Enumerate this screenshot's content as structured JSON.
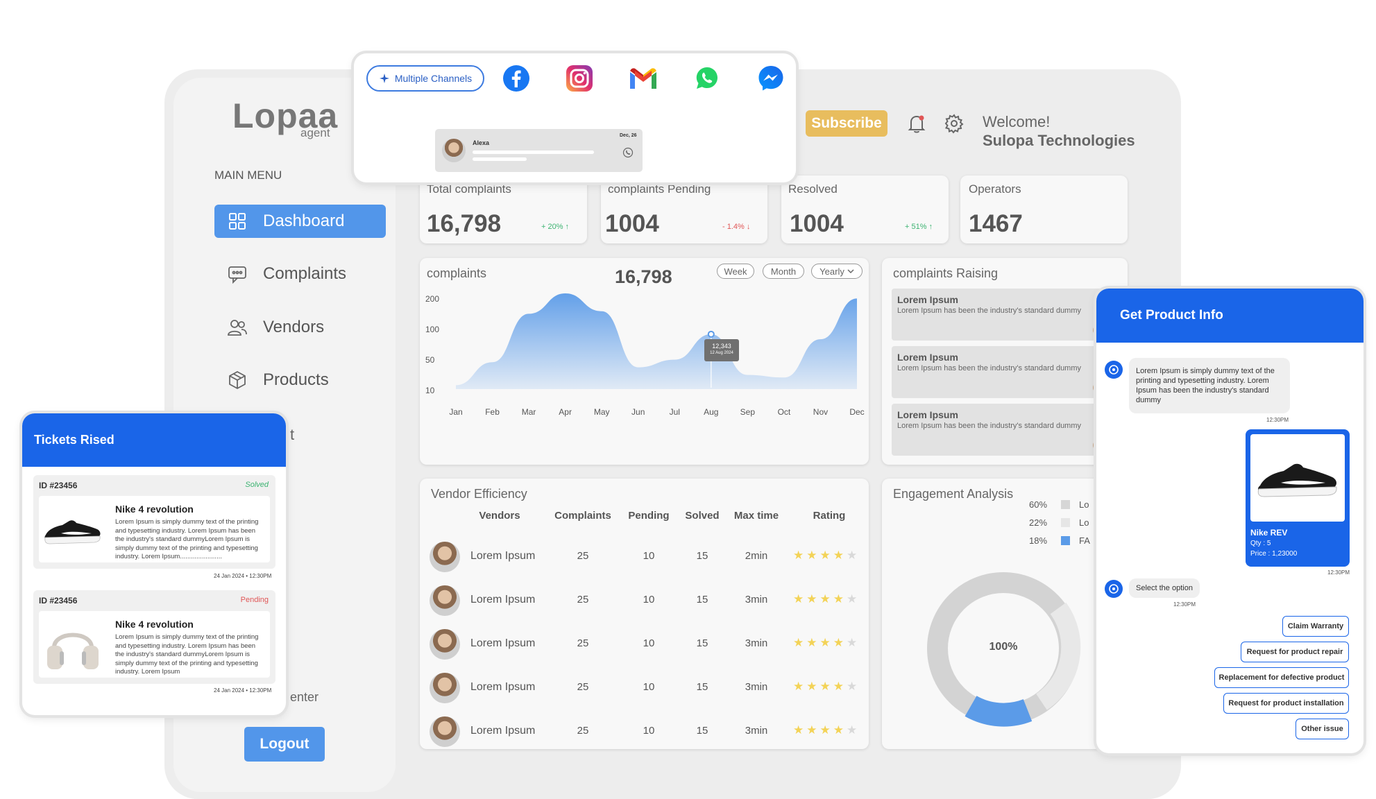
{
  "brand": {
    "name": "Lopaa",
    "sub": "agent"
  },
  "sidebar": {
    "menu_label": "MAIN MENU",
    "items": [
      {
        "label": "Dashboard",
        "icon": "grid-icon"
      },
      {
        "label": "Complaints",
        "icon": "chat-icon"
      },
      {
        "label": "Vendors",
        "icon": "users-icon"
      },
      {
        "label": "Products",
        "icon": "box-icon"
      }
    ],
    "partial_item": "t",
    "partial_item2": "enter",
    "logout_label": "Logout"
  },
  "header": {
    "subscribe_label": "Subscribe",
    "welcome": "Welcome!",
    "company": "Sulopa Technologies"
  },
  "stats": [
    {
      "title": "Total complaints",
      "value": "16,798",
      "trend": "+ 20% ↑",
      "trend_color": "#3cb371"
    },
    {
      "title": "complaints Pending",
      "value": "1004",
      "trend": "- 1.4% ↓",
      "trend_color": "#e05555"
    },
    {
      "title": "Resolved",
      "value": "1004",
      "trend": "+ 51% ↑",
      "trend_color": "#3cb371"
    },
    {
      "title": "Operators",
      "value": "1467",
      "trend": ""
    }
  ],
  "complaints_chart": {
    "title": "complaints",
    "total": "16,798",
    "filters": [
      "Week",
      "Month",
      "Yearly"
    ],
    "tooltip": {
      "value": "12,343",
      "date": "12 Aug 2024"
    }
  },
  "chart_data": {
    "type": "area",
    "categories": [
      "Jan",
      "Feb",
      "Mar",
      "Apr",
      "May",
      "Jun",
      "Jul",
      "Aug",
      "Sep",
      "Oct",
      "Nov",
      "Dec"
    ],
    "y_ticks": [
      "200",
      "100",
      "50",
      "10"
    ],
    "series": [
      {
        "values": [
          5,
          50,
          145,
          185,
          150,
          40,
          55,
          105,
          25,
          20,
          95,
          175
        ]
      }
    ],
    "color": "#5b9be8",
    "grid": false
  },
  "complaints_raising": {
    "title": "complaints Raising",
    "items": [
      {
        "title": "Lorem Ipsum",
        "text": "Lorem Ipsum has been the industry's standard dummy"
      },
      {
        "title": "Lorem Ipsum",
        "text": "Lorem Ipsum has been the industry's standard dummy"
      },
      {
        "title": "Lorem Ipsum",
        "text": "Lorem Ipsum has been the industry's standard dummy"
      }
    ]
  },
  "vendor_efficiency": {
    "title": "Vendor Efficiency",
    "headers": [
      "Vendors",
      "Complaints",
      "Pending",
      "Solved",
      "Max time",
      "Rating"
    ],
    "rows": [
      {
        "name": "Lorem Ipsum",
        "complaints": "25",
        "pending": "10",
        "solved": "15",
        "max_time": "2min",
        "rating": 4
      },
      {
        "name": "Lorem Ipsum",
        "complaints": "25",
        "pending": "10",
        "solved": "15",
        "max_time": "3min",
        "rating": 4
      },
      {
        "name": "Lorem Ipsum",
        "complaints": "25",
        "pending": "10",
        "solved": "15",
        "max_time": "3min",
        "rating": 4
      },
      {
        "name": "Lorem Ipsum",
        "complaints": "25",
        "pending": "10",
        "solved": "15",
        "max_time": "3min",
        "rating": 4
      },
      {
        "name": "Lorem Ipsum",
        "complaints": "25",
        "pending": "10",
        "solved": "15",
        "max_time": "3min",
        "rating": 4
      }
    ]
  },
  "engagement": {
    "title": "Engagement Analysis",
    "legend": [
      {
        "pct": "60%",
        "label": "Lo",
        "color": "#d6d6d6"
      },
      {
        "pct": "22%",
        "label": "Lo",
        "color": "#e6e6e6"
      },
      {
        "pct": "18%",
        "label": "FA",
        "color": "#5b9be8"
      }
    ],
    "center_label": "100%"
  },
  "channels": {
    "button_label": "Multiple Channels",
    "icons": [
      "facebook-icon",
      "instagram-icon",
      "gmail-icon",
      "whatsapp-icon",
      "messenger-icon"
    ],
    "message": {
      "name": "Alexa",
      "date": "Dec, 26"
    }
  },
  "tickets": {
    "title": "Tickets Rised",
    "items": [
      {
        "id": "ID #23456",
        "status": "Solved",
        "status_color": "#3cb371",
        "product": "Nike 4 revolution",
        "desc": "Lorem Ipsum is simply dummy text of the printing and typesetting industry. Lorem Ipsum has been the industry's standard dummyLorem Ipsum is simply dummy text of the printing and typesetting industry. Lorem Ipsum.......................",
        "date": "24 Jan 2024 • 12:30PM"
      },
      {
        "id": "ID #23456",
        "status": "Pending",
        "status_color": "#e05555",
        "product": "Nike 4 revolution",
        "desc": "Lorem Ipsum is simply dummy text of the printing and typesetting industry. Lorem Ipsum has been the industry's standard dummyLorem Ipsum is simply dummy text of the printing and typesetting industry. Lorem Ipsum",
        "date": "24 Jan 2024 • 12:30PM"
      }
    ]
  },
  "product_info": {
    "title": "Get Product Info",
    "bot_message": "Lorem Ipsum is simply dummy text of the printing and typesetting industry. Lorem Ipsum has been the industry's standard dummy",
    "time1": "12:30PM",
    "product": {
      "name": "Nike REV",
      "qty": "Qty : 5",
      "price": "Price : 1,23000"
    },
    "time2": "12:30PM",
    "select_prompt": "Select the option",
    "time3": "12:30PM",
    "options": [
      "Claim Warranty",
      "Request for product repair",
      "Replacement for defective product",
      "Request for product installation",
      "Other issue"
    ]
  }
}
